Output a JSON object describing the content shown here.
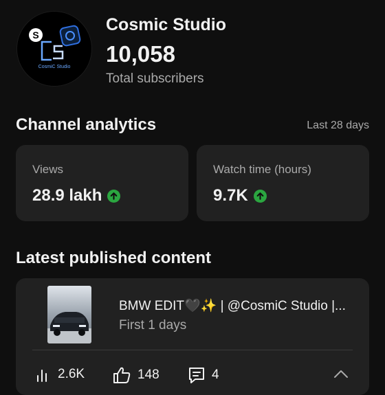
{
  "channel": {
    "name": "Cosmic Studio",
    "subscriber_count": "10,058",
    "subscriber_label": "Total subscribers",
    "avatar_text": "CosmiC Studio"
  },
  "analytics": {
    "title": "Channel analytics",
    "range": "Last 28 days",
    "metrics": [
      {
        "label": "Views",
        "value": "28.9 lakh"
      },
      {
        "label": "Watch time (hours)",
        "value": "9.7K"
      }
    ]
  },
  "latest": {
    "title": "Latest published content",
    "video": {
      "title": "BMW EDIT🖤✨ | @CosmiC Studio |...",
      "age": "First 1 days",
      "views": "2.6K",
      "likes": "148",
      "comments": "4"
    }
  },
  "colors": {
    "background": "#0f0f0f",
    "card": "#212121",
    "up_indicator": "#2ba640",
    "secondary_text": "#aaaaaa"
  }
}
